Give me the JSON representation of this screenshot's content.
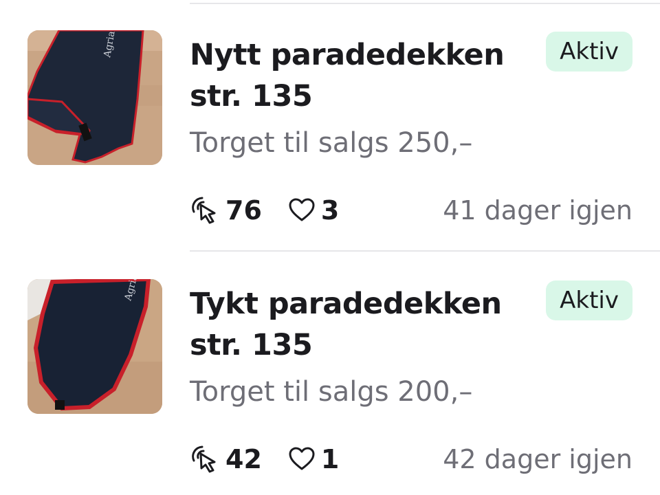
{
  "colors": {
    "badge_bg": "#d9f7e8",
    "divider": "#e6e6e9",
    "muted_text": "#6e6e76",
    "primary_text": "#1b1b1f"
  },
  "listings": [
    {
      "title_line1": "Nytt paradedekken",
      "title_line2": "str. 135",
      "status": "Aktiv",
      "price_text": "Torget til salgs 250,–",
      "clicks": "76",
      "favorites": "3",
      "time_left": "41 dager igjen",
      "image_icon": "horse-blanket-photo",
      "logo_text": "Agria"
    },
    {
      "title_line1": "Tykt paradedekken",
      "title_line2": "str. 135",
      "status": "Aktiv",
      "price_text": "Torget til salgs 200,–",
      "clicks": "42",
      "favorites": "1",
      "time_left": "42 dager igjen",
      "image_icon": "horse-blanket-photo",
      "logo_text": "Agria"
    }
  ],
  "icons": {
    "clicks": "cursor-click-icon",
    "favorites": "heart-outline-icon"
  }
}
